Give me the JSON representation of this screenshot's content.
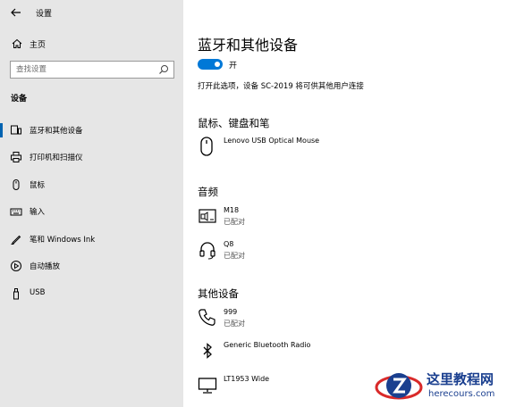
{
  "window": {
    "title": "设置"
  },
  "sidebar": {
    "home_label": "主页",
    "search_placeholder": "查找设置",
    "section_title": "设备",
    "items": [
      {
        "label": "蓝牙和其他设备",
        "icon": "bluetooth-devices-icon",
        "active": true
      },
      {
        "label": "打印机和扫描仪",
        "icon": "printer-icon"
      },
      {
        "label": "鼠标",
        "icon": "mouse-icon"
      },
      {
        "label": "输入",
        "icon": "keyboard-icon"
      },
      {
        "label": "笔和 Windows Ink",
        "icon": "pen-icon"
      },
      {
        "label": "自动播放",
        "icon": "autoplay-icon"
      },
      {
        "label": "USB",
        "icon": "usb-icon"
      }
    ]
  },
  "main": {
    "title": "蓝牙和其他设备",
    "bluetooth_toggle": {
      "state_label": "开",
      "on": true
    },
    "description": "打开此选项，设备 SC-2019 将可供其他用户连接",
    "sections": {
      "mouse_keyboard_pen": {
        "title": "鼠标、键盘和笔",
        "devices": [
          {
            "name": "Lenovo USB Optical Mouse",
            "status": "",
            "icon": "mouse-icon"
          }
        ]
      },
      "audio": {
        "title": "音频",
        "devices": [
          {
            "name": "M18",
            "status": "已配对",
            "icon": "display-audio-icon"
          },
          {
            "name": "Q8",
            "status": "已配对",
            "icon": "headset-icon"
          }
        ]
      },
      "other": {
        "title": "其他设备",
        "devices": [
          {
            "name": "999",
            "status": "已配对",
            "icon": "phone-icon"
          },
          {
            "name": "Generic Bluetooth Radio",
            "status": "",
            "icon": "bluetooth-icon"
          },
          {
            "name": "LT1953 Wide",
            "status": "",
            "icon": "monitor-icon"
          }
        ]
      }
    }
  },
  "watermark": {
    "line1": "这里教程网",
    "line2": "herecours.com"
  },
  "colors": {
    "accent": "#0078d7",
    "sidebar_bg": "#e6e6e6",
    "logo_blue": "#1a3f8f",
    "logo_red": "#d92a2a"
  }
}
